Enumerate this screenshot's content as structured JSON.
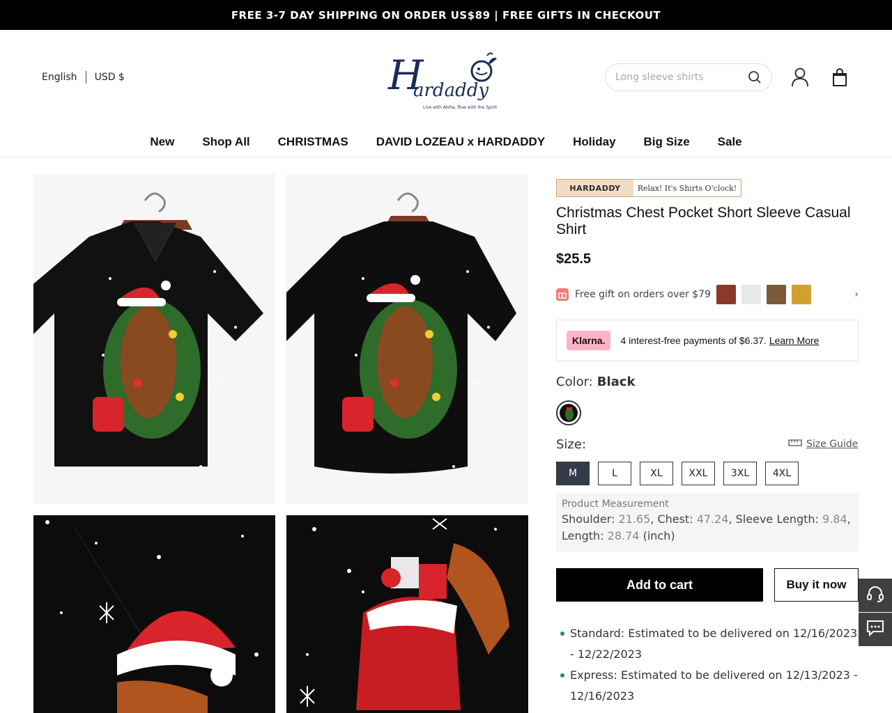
{
  "announcement": "FREE 3-7 DAY SHIPPING ON ORDER US$89 | FREE GIFTS IN CHECKOUT",
  "header": {
    "language": "English",
    "currency": "USD $",
    "brand": "Hardaddy",
    "tagline": "Live with Aloha, flow with the Spirit",
    "search_placeholder": "Long sleeve shirts"
  },
  "nav": [
    "New",
    "Shop All",
    "CHRISTMAS",
    "DAVID LOZEAU x HARDADDY",
    "Holiday",
    "Big Size",
    "Sale"
  ],
  "product": {
    "banner_brand": "HARDADDY",
    "banner_slogan": "Relax! It's Shirts O'clock!",
    "title": "Christmas Chest Pocket Short Sleeve Casual Shirt",
    "price": "$25.5",
    "gift_text": "Free gift on orders over $79",
    "klarna_badge": "Klarna.",
    "klarna_text": "4 interest-free payments of $6.37.",
    "klarna_link": "Learn More",
    "color_label": "Color:",
    "color_value": "Black",
    "size_label": "Size:",
    "size_guide": "Size Guide",
    "sizes": [
      "M",
      "L",
      "XL",
      "XXL",
      "3XL",
      "4XL"
    ],
    "selected_size": "M",
    "measurement_title": "Product Measurement",
    "measurements": {
      "shoulder_label": "Shoulder: ",
      "shoulder": "21.65",
      "chest_label": ", Chest: ",
      "chest": "47.24",
      "sleeve_label": ", Sleeve Length: ",
      "sleeve": "9.84",
      "length_label": ", Length: ",
      "length": "28.74",
      "unit": " (inch)"
    },
    "add_to_cart": "Add to cart",
    "buy_now": "Buy it now",
    "delivery": [
      "Standard: Estimated to be delivered on 12/16/2023 - 12/22/2023",
      "Express: Estimated to be delivered on 12/13/2023 - 12/16/2023"
    ]
  },
  "icons": [
    "search-icon",
    "user-icon",
    "bag-icon",
    "gift-icon",
    "chevron-right-icon",
    "ruler-icon",
    "headset-icon",
    "chat-icon"
  ],
  "colors": {
    "accent_black": "#000000",
    "klarna_pink": "#ffb3c7",
    "size_active": "#333c48",
    "delivery_dot": "#2a8a5a"
  }
}
